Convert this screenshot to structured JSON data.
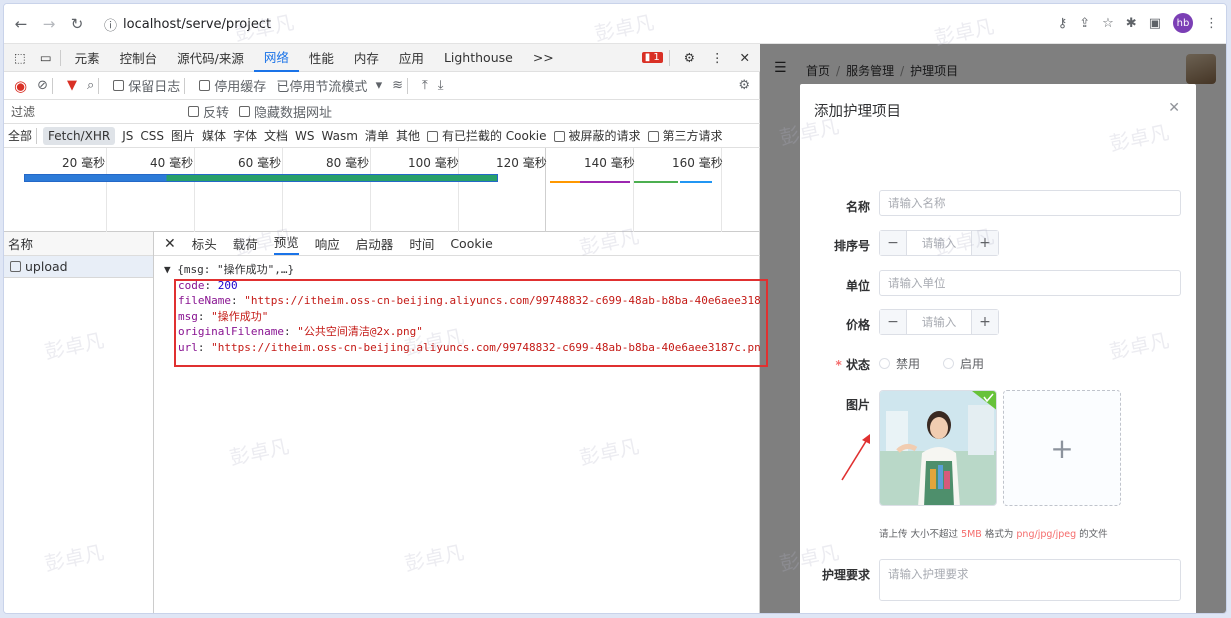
{
  "browser": {
    "url": "localhost/serve/project",
    "profile": "hb"
  },
  "devtools": {
    "tabs": [
      "元素",
      "控制台",
      "源代码/来源",
      "网络",
      "性能",
      "内存",
      "应用",
      "Lighthouse",
      ">>"
    ],
    "active_tab": "网络",
    "error_count": "1",
    "toolbar": {
      "preserve_log": "保留日志",
      "disable_cache": "停用缓存",
      "throttle": "已停用节流模式"
    },
    "filter_placeholder": "过滤",
    "invert": "反转",
    "hide_data_urls": "隐藏数据网址",
    "types": [
      "全部",
      "Fetch/XHR",
      "JS",
      "CSS",
      "图片",
      "媒体",
      "字体",
      "文档",
      "WS",
      "Wasm",
      "清单",
      "其他"
    ],
    "blocked_cookies": "有已拦截的 Cookie",
    "blocked_requests": "被屏蔽的请求",
    "third_party": "第三方请求",
    "timeline_ticks": [
      "20 毫秒",
      "40 毫秒",
      "60 毫秒",
      "80 毫秒",
      "100 毫秒",
      "120 毫秒",
      "140 毫秒",
      "160 毫秒"
    ],
    "name_header": "名称",
    "request_name": "upload",
    "detail_tabs": [
      "标头",
      "载荷",
      "预览",
      "响应",
      "启动器",
      "时间",
      "Cookie"
    ],
    "active_detail_tab": "预览",
    "preview": {
      "summary": "▼ {msg: \"操作成功\",…}",
      "code_key": "code",
      "code_val": "200",
      "fileName_key": "fileName",
      "fileName_val": "\"https://itheim.oss-cn-beijing.aliyuncs.com/99748832-c699-48ab-b8ba-40e6aee318",
      "msg_key": "msg",
      "msg_val": "\"操作成功\"",
      "originalFilename_key": "originalFilename",
      "originalFilename_val": "\"公共空间清洁@2x.png\"",
      "url_key": "url",
      "url_val": "\"https://itheim.oss-cn-beijing.aliyuncs.com/99748832-c699-48ab-b8ba-40e6aee3187c.pn"
    }
  },
  "app": {
    "breadcrumb": [
      "首页",
      "服务管理",
      "护理项目"
    ],
    "dialog": {
      "title": "添加护理项目",
      "name_label": "名称",
      "name_placeholder": "请输入名称",
      "order_label": "排序号",
      "order_placeholder": "请输入",
      "unit_label": "单位",
      "unit_placeholder": "请输入单位",
      "price_label": "价格",
      "price_placeholder": "请输入",
      "status_label": "状态",
      "status_disabled": "禁用",
      "status_enabled": "启用",
      "image_label": "图片",
      "hint_prefix": "请上传 大小不超过",
      "hint_size": "5MB",
      "hint_mid": "格式为",
      "hint_formats": "png/jpg/jpeg",
      "hint_suffix": "的文件",
      "requirement_label": "护理要求",
      "requirement_placeholder": "请输入护理要求"
    }
  },
  "watermark": "彭卓凡"
}
